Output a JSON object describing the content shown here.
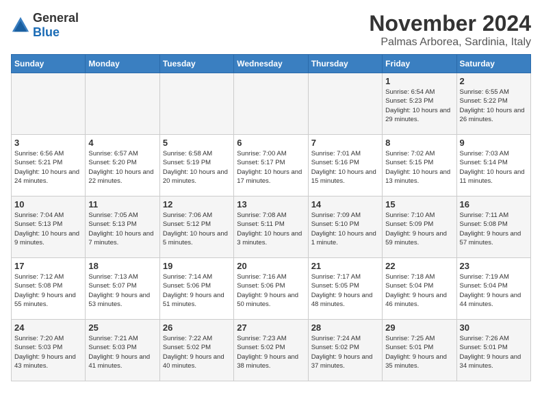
{
  "header": {
    "logo_general": "General",
    "logo_blue": "Blue",
    "month": "November 2024",
    "location": "Palmas Arborea, Sardinia, Italy"
  },
  "weekdays": [
    "Sunday",
    "Monday",
    "Tuesday",
    "Wednesday",
    "Thursday",
    "Friday",
    "Saturday"
  ],
  "weeks": [
    [
      {
        "day": "",
        "info": ""
      },
      {
        "day": "",
        "info": ""
      },
      {
        "day": "",
        "info": ""
      },
      {
        "day": "",
        "info": ""
      },
      {
        "day": "",
        "info": ""
      },
      {
        "day": "1",
        "info": "Sunrise: 6:54 AM\nSunset: 5:23 PM\nDaylight: 10 hours and 29 minutes."
      },
      {
        "day": "2",
        "info": "Sunrise: 6:55 AM\nSunset: 5:22 PM\nDaylight: 10 hours and 26 minutes."
      }
    ],
    [
      {
        "day": "3",
        "info": "Sunrise: 6:56 AM\nSunset: 5:21 PM\nDaylight: 10 hours and 24 minutes."
      },
      {
        "day": "4",
        "info": "Sunrise: 6:57 AM\nSunset: 5:20 PM\nDaylight: 10 hours and 22 minutes."
      },
      {
        "day": "5",
        "info": "Sunrise: 6:58 AM\nSunset: 5:19 PM\nDaylight: 10 hours and 20 minutes."
      },
      {
        "day": "6",
        "info": "Sunrise: 7:00 AM\nSunset: 5:17 PM\nDaylight: 10 hours and 17 minutes."
      },
      {
        "day": "7",
        "info": "Sunrise: 7:01 AM\nSunset: 5:16 PM\nDaylight: 10 hours and 15 minutes."
      },
      {
        "day": "8",
        "info": "Sunrise: 7:02 AM\nSunset: 5:15 PM\nDaylight: 10 hours and 13 minutes."
      },
      {
        "day": "9",
        "info": "Sunrise: 7:03 AM\nSunset: 5:14 PM\nDaylight: 10 hours and 11 minutes."
      }
    ],
    [
      {
        "day": "10",
        "info": "Sunrise: 7:04 AM\nSunset: 5:13 PM\nDaylight: 10 hours and 9 minutes."
      },
      {
        "day": "11",
        "info": "Sunrise: 7:05 AM\nSunset: 5:13 PM\nDaylight: 10 hours and 7 minutes."
      },
      {
        "day": "12",
        "info": "Sunrise: 7:06 AM\nSunset: 5:12 PM\nDaylight: 10 hours and 5 minutes."
      },
      {
        "day": "13",
        "info": "Sunrise: 7:08 AM\nSunset: 5:11 PM\nDaylight: 10 hours and 3 minutes."
      },
      {
        "day": "14",
        "info": "Sunrise: 7:09 AM\nSunset: 5:10 PM\nDaylight: 10 hours and 1 minute."
      },
      {
        "day": "15",
        "info": "Sunrise: 7:10 AM\nSunset: 5:09 PM\nDaylight: 9 hours and 59 minutes."
      },
      {
        "day": "16",
        "info": "Sunrise: 7:11 AM\nSunset: 5:08 PM\nDaylight: 9 hours and 57 minutes."
      }
    ],
    [
      {
        "day": "17",
        "info": "Sunrise: 7:12 AM\nSunset: 5:08 PM\nDaylight: 9 hours and 55 minutes."
      },
      {
        "day": "18",
        "info": "Sunrise: 7:13 AM\nSunset: 5:07 PM\nDaylight: 9 hours and 53 minutes."
      },
      {
        "day": "19",
        "info": "Sunrise: 7:14 AM\nSunset: 5:06 PM\nDaylight: 9 hours and 51 minutes."
      },
      {
        "day": "20",
        "info": "Sunrise: 7:16 AM\nSunset: 5:06 PM\nDaylight: 9 hours and 50 minutes."
      },
      {
        "day": "21",
        "info": "Sunrise: 7:17 AM\nSunset: 5:05 PM\nDaylight: 9 hours and 48 minutes."
      },
      {
        "day": "22",
        "info": "Sunrise: 7:18 AM\nSunset: 5:04 PM\nDaylight: 9 hours and 46 minutes."
      },
      {
        "day": "23",
        "info": "Sunrise: 7:19 AM\nSunset: 5:04 PM\nDaylight: 9 hours and 44 minutes."
      }
    ],
    [
      {
        "day": "24",
        "info": "Sunrise: 7:20 AM\nSunset: 5:03 PM\nDaylight: 9 hours and 43 minutes."
      },
      {
        "day": "25",
        "info": "Sunrise: 7:21 AM\nSunset: 5:03 PM\nDaylight: 9 hours and 41 minutes."
      },
      {
        "day": "26",
        "info": "Sunrise: 7:22 AM\nSunset: 5:02 PM\nDaylight: 9 hours and 40 minutes."
      },
      {
        "day": "27",
        "info": "Sunrise: 7:23 AM\nSunset: 5:02 PM\nDaylight: 9 hours and 38 minutes."
      },
      {
        "day": "28",
        "info": "Sunrise: 7:24 AM\nSunset: 5:02 PM\nDaylight: 9 hours and 37 minutes."
      },
      {
        "day": "29",
        "info": "Sunrise: 7:25 AM\nSunset: 5:01 PM\nDaylight: 9 hours and 35 minutes."
      },
      {
        "day": "30",
        "info": "Sunrise: 7:26 AM\nSunset: 5:01 PM\nDaylight: 9 hours and 34 minutes."
      }
    ]
  ]
}
